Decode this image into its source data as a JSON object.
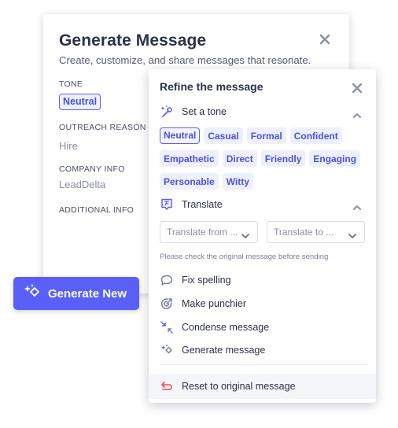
{
  "generate_dialog": {
    "title": "Generate Message",
    "subtitle": "Create, customize, and share messages that resonate.",
    "close_icon": "close-icon",
    "fields": {
      "tone": {
        "label": "TONE",
        "value": "Neutral"
      },
      "outreach_reason": {
        "label": "OUTREACH REASON",
        "value": "Hire"
      },
      "company_info": {
        "label": "COMPANY INFO",
        "value": "LeadDelta"
      },
      "additional_info": {
        "label": "ADDITIONAL INFO"
      }
    }
  },
  "generate_new_button": {
    "label": "Generate New",
    "icon": "sparkles-icon"
  },
  "refine_panel": {
    "title": "Refine the message",
    "close_icon": "close-icon",
    "set_tone": {
      "label": "Set a tone",
      "icon": "magic-wand-icon",
      "expanded": true,
      "selected": "Neutral",
      "options": [
        "Neutral",
        "Casual",
        "Formal",
        "Confident",
        "Empathetic",
        "Direct",
        "Friendly",
        "Engaging",
        "Personable",
        "Witty"
      ]
    },
    "translate": {
      "label": "Translate",
      "icon": "translate-icon",
      "expanded": true,
      "from_placeholder": "Translate from ...",
      "to_placeholder": "Translate to ...",
      "note": "Please check the original message before sending"
    },
    "actions": [
      {
        "label": "Fix spelling",
        "icon": "speech-bubble-icon"
      },
      {
        "label": "Make punchier",
        "icon": "target-icon"
      },
      {
        "label": "Condense message",
        "icon": "condense-arrows-icon"
      },
      {
        "label": "Generate message",
        "icon": "sparkles-icon"
      }
    ],
    "reset": {
      "label": "Reset to original message",
      "icon": "undo-arrow-icon"
    }
  },
  "colors": {
    "accent": "#5a5ff7",
    "chip_bg": "#eef0fd",
    "chip_text": "#4b52d9",
    "reset_icon": "#ef4b4b"
  }
}
